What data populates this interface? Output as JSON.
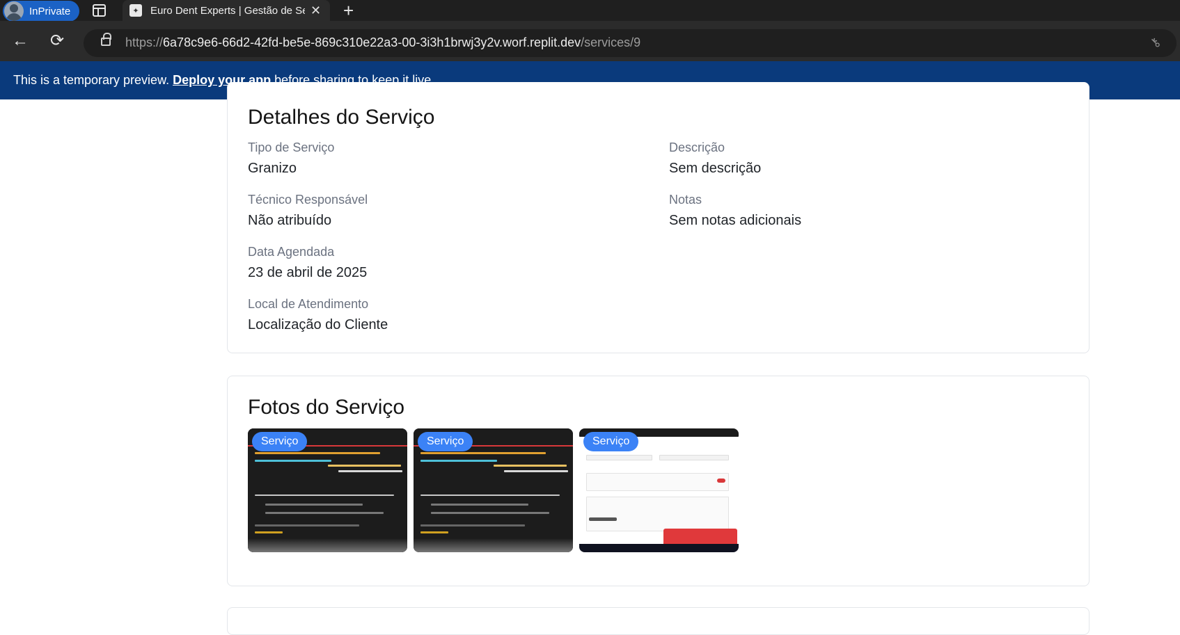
{
  "browser": {
    "inprivate_label": "InPrivate",
    "tab_title": "Euro Dent Experts | Gestão de Ser",
    "url_prefix": "https://",
    "url_host": "6a78c9e6-66d2-42fd-be5e-869c310e22a3-00-3i3h1brwj3y2v.worf.replit.dev",
    "url_path": "/services/9"
  },
  "banner": {
    "text_before": "This is a temporary preview.",
    "link": "Deploy your app",
    "text_after": "before sharing to keep it live."
  },
  "details": {
    "title": "Detalhes do Serviço",
    "fields": [
      {
        "label": "Tipo de Serviço",
        "value": "Granizo"
      },
      {
        "label": "Técnico Responsável",
        "value": "Não atribuído"
      },
      {
        "label": "Data Agendada",
        "value": "23 de abril de 2025"
      },
      {
        "label": "Local de Atendimento",
        "value": "Localização do Cliente"
      },
      {
        "label": "Descrição",
        "value": "Sem descrição"
      },
      {
        "label": "Notas",
        "value": "Sem notas adicionais"
      }
    ]
  },
  "photos": {
    "title": "Fotos do Serviço",
    "items": [
      {
        "badge": "Serviço"
      },
      {
        "badge": "Serviço"
      },
      {
        "badge": "Serviço"
      }
    ]
  },
  "colors": {
    "banner_bg": "#0a3a7c",
    "badge_bg": "#3b82f6",
    "inprivate_bg": "#1b62c5"
  }
}
